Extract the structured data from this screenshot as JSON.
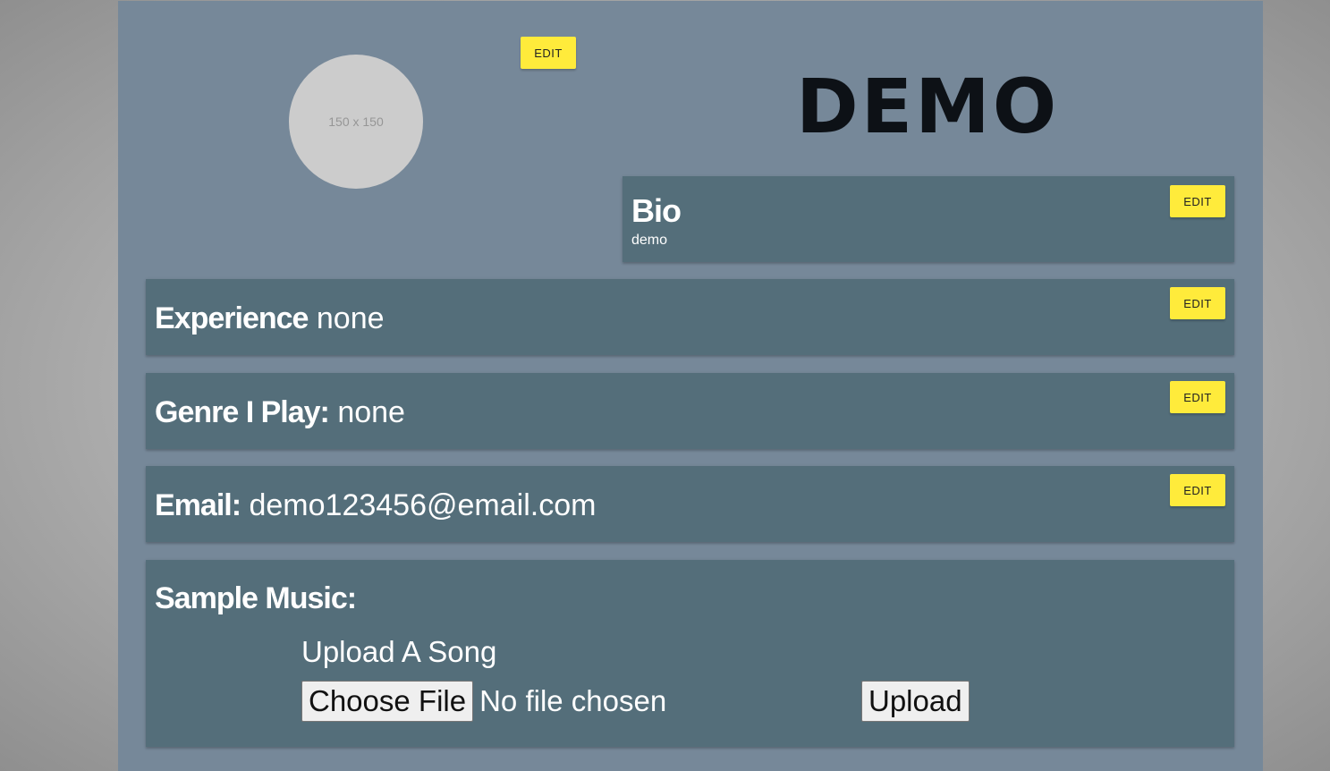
{
  "profile": {
    "avatar_placeholder": "150 x 150",
    "avatar_edit_label": "EDIT",
    "name": "DEMO"
  },
  "bio": {
    "heading": "Bio",
    "text": "demo",
    "edit_label": "EDIT"
  },
  "experience": {
    "label": "Experience",
    "value": " none",
    "edit_label": "EDIT"
  },
  "genre": {
    "label": "Genre I Play:",
    "value": " none",
    "edit_label": "EDIT"
  },
  "email": {
    "label": "Email:",
    "value": " demo123456@email.com",
    "edit_label": "EDIT"
  },
  "sample_music": {
    "heading": "Sample Music:",
    "upload_heading": "Upload A Song",
    "choose_file_label": "Choose File",
    "file_status": "No file chosen",
    "upload_label": "Upload"
  },
  "colors": {
    "container_bg": "#768899",
    "card_bg": "#546e7a",
    "edit_button_bg": "#ffeb3b",
    "avatar_bg": "#cccccc",
    "title_color": "#0d1116"
  }
}
